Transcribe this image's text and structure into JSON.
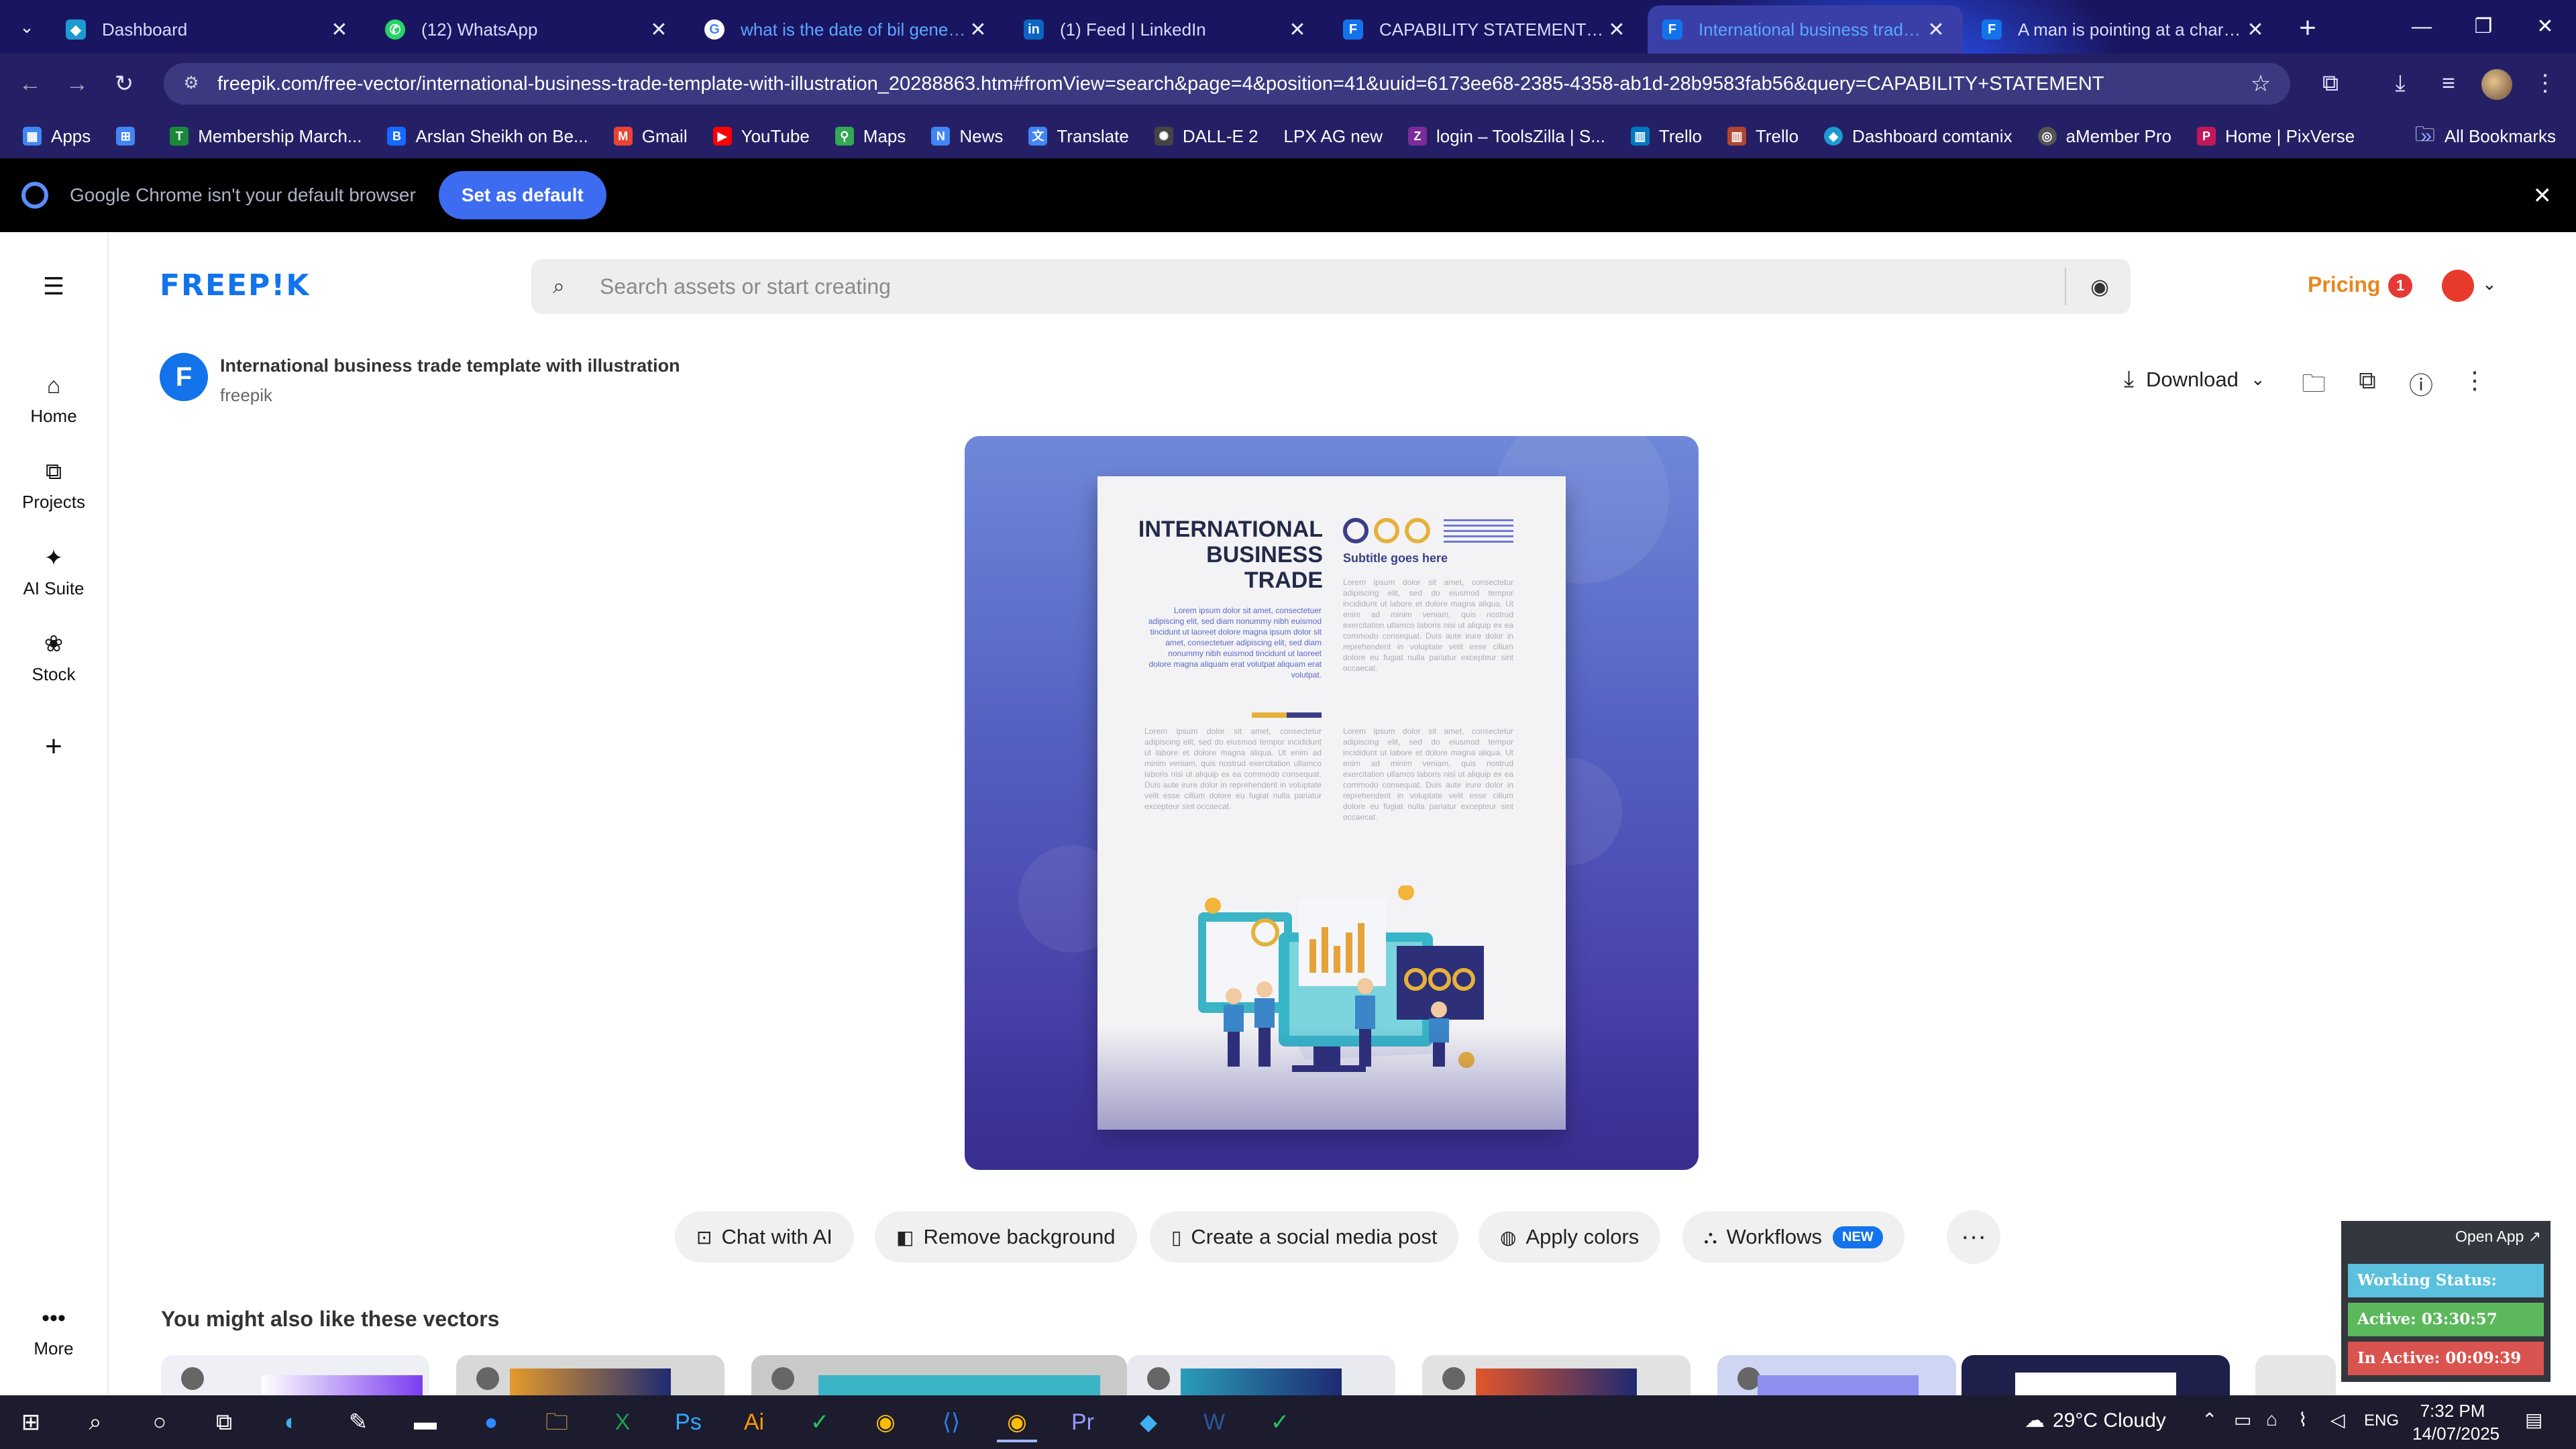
{
  "browser": {
    "tabs": [
      {
        "title": "Dashboard",
        "icon": "dashboard-favicon",
        "color": "#1d9bd1"
      },
      {
        "title": "(12) WhatsApp",
        "icon": "whatsapp-favicon",
        "color": "#25d366"
      },
      {
        "title": "what is the date of bil generati",
        "icon": "google-favicon",
        "color": "#ffffff"
      },
      {
        "title": "(1) Feed | LinkedIn",
        "icon": "linkedin-favicon",
        "color": "#0a66c2"
      },
      {
        "title": "CAPABILITY STATEMENT vector",
        "icon": "freepik-favicon",
        "color": "#1273eb"
      },
      {
        "title": "International business trade te",
        "icon": "freepik-favicon",
        "color": "#1273eb"
      },
      {
        "title": "A man is pointing at a chart th",
        "icon": "freepik-favicon",
        "color": "#1273eb"
      }
    ],
    "url": "freepik.com/free-vector/international-business-trade-template-with-illustration_20288863.htm#fromView=search&page=4&position=41&uuid=6173ee68-2385-4358-ab1d-28b9583fab56&query=CAPABILITY+STATEMENT",
    "bookmarks": [
      {
        "label": "Apps",
        "icon": "apps-grid-icon",
        "color": "#4285f4"
      },
      {
        "label": "",
        "icon": "grid-icon",
        "color": "#4285f4"
      },
      {
        "label": "Membership March...",
        "icon": "membership-favicon",
        "color": "#1a8a3a"
      },
      {
        "label": "Arslan Sheikh on Be...",
        "icon": "behance-favicon",
        "color": "#1769ff"
      },
      {
        "label": "Gmail",
        "icon": "gmail-favicon",
        "color": "#ea4335"
      },
      {
        "label": "YouTube",
        "icon": "youtube-favicon",
        "color": "#ff0000"
      },
      {
        "label": "Maps",
        "icon": "maps-favicon",
        "color": "#34a853"
      },
      {
        "label": "News",
        "icon": "news-favicon",
        "color": "#4285f4"
      },
      {
        "label": "Translate",
        "icon": "translate-favicon",
        "color": "#4285f4"
      },
      {
        "label": "DALL-E 2",
        "icon": "openai-favicon",
        "color": "#444444"
      },
      {
        "label": "LPX AG new",
        "icon": "",
        "color": ""
      },
      {
        "label": "login – ToolsZilla | S...",
        "icon": "toolszilla-favicon",
        "color": "#7b2c9c"
      },
      {
        "label": "Trello",
        "icon": "trello-favicon",
        "color": "#0079bf"
      },
      {
        "label": "Trello",
        "icon": "trello-favicon",
        "color": "#b04632"
      },
      {
        "label": "Dashboard comtanix",
        "icon": "comtanix-favicon",
        "color": "#1d9bd1"
      },
      {
        "label": "aMember Pro",
        "icon": "amember-favicon",
        "color": "#555555"
      },
      {
        "label": "Home | PixVerse",
        "icon": "pixverse-favicon",
        "color": "#c2185b"
      }
    ],
    "all_bookmarks": "All Bookmarks"
  },
  "infobar": {
    "message": "Google Chrome isn't your default browser",
    "button": "Set as default"
  },
  "sidebar": {
    "items": [
      {
        "label": "Home",
        "icon": "home-icon"
      },
      {
        "label": "Projects",
        "icon": "projects-icon"
      },
      {
        "label": "AI Suite",
        "icon": "ai-sparkle-icon"
      },
      {
        "label": "Stock",
        "icon": "stock-icon"
      },
      {
        "label": "",
        "icon": "plus-icon"
      }
    ],
    "more": "More"
  },
  "header": {
    "logo": "FREEP!K",
    "search_placeholder": "Search assets or start creating",
    "pricing": "Pricing",
    "notifications": "1"
  },
  "asset": {
    "badge": "F",
    "title": "International business trade template with illustration",
    "author": "freepik",
    "download": "Download"
  },
  "poster": {
    "title_line1": "INTERNATIONAL",
    "title_line2": "BUSINESS",
    "title_line3": "TRADE",
    "subtitle": "Subtitle goes here",
    "lorem": "Lorem ipsum dolor sit amet, consectetur adipiscing elit, sed do eiusmod tempor incididunt ut labore et dolore magna aliqua. Ut enim ad minim veniam, quis nostrud exercitation ullamco laboris nisi ut aliquip ex ea commodo consequat. Duis aute irure dolor in reprehenderit in voluptate velit esse cillum dolore eu fugiat nulla pariatur excepteur sint occaecat.",
    "lorem_blue": "Lorem ipsum dolor sit amet, consectetuer adipiscing elit, sed diam nonummy nibh euismod tincidunt ut laoreet dolore magna ipsum dolor sit amet, consectetuer adipiscing elit, sed diam nonummy nibh euismod tincidunt ut laoreet dolore magna aliquam erat volutpat aliquam erat volutpat."
  },
  "actions": [
    {
      "label": "Chat with AI",
      "icon": "chat-icon"
    },
    {
      "label": "Remove background",
      "icon": "remove-bg-icon"
    },
    {
      "label": "Create a social media post",
      "icon": "phone-icon"
    },
    {
      "label": "Apply colors",
      "icon": "palette-icon"
    },
    {
      "label": "Workflows",
      "icon": "workflow-icon",
      "badge": "NEW"
    }
  ],
  "similar_heading": "You might also like these vectors",
  "tracker": {
    "open_app": "Open App ↗",
    "status": "Working Status: Active",
    "active": "Active: 03:30:57",
    "inactive": "In Active: 00:09:39",
    "colors": {
      "status": "#5bc0de",
      "active": "#5cb85c",
      "inactive": "#d9534f"
    }
  },
  "taskbar": {
    "weather": "29°C  Cloudy",
    "language": "ENG",
    "time": "7:32 PM",
    "date": "14/07/2025"
  }
}
